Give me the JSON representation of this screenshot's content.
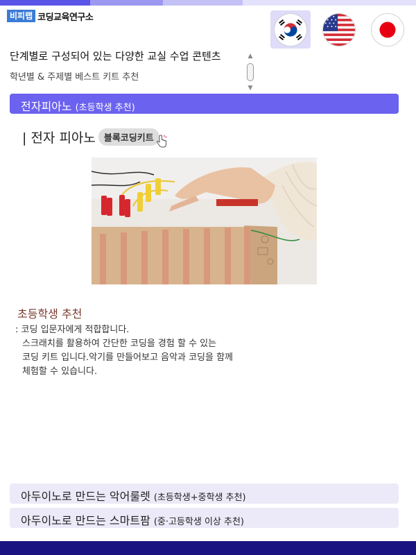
{
  "header": {
    "logo_badge": "비피랩",
    "logo_text": "코딩교육연구소",
    "languages": [
      {
        "code": "ko",
        "icon": "korea-flag-icon",
        "active": true
      },
      {
        "code": "en",
        "icon": "usa-flag-icon",
        "active": false
      },
      {
        "code": "ja",
        "icon": "japan-flag-icon",
        "active": false
      }
    ]
  },
  "intro": {
    "line1": "단계별로 구성되어 있는 다양한 교실 수업 콘텐츠",
    "line2": "학년별 & 주제별 베스트 키트 추천"
  },
  "accordion": [
    {
      "title": "전자피아노",
      "subtitle": "(초등학생 추천)",
      "expanded": true
    },
    {
      "title": "아두이노로 만드는 악어룰렛",
      "subtitle": "(초등학생+중학생 추천)",
      "expanded": false
    },
    {
      "title": "아두이노로 만드는 스마트팜",
      "subtitle": "(중·고등학생 이상 추천)",
      "expanded": false
    }
  ],
  "panel": {
    "heading": "| 전자 피아노",
    "tag": "블록코딩키트",
    "photo_icon": "electronic-piano-kit-photo",
    "recommend_title": "초등학생 추천",
    "desc_lines": [
      ": 코딩 입문자에게 적합합니다.",
      "스크래치를 활용하여 간단한 코딩을 경험 할 수 있는",
      "코딩 키트 입니다.악기를 만들어보고 음악과 코딩을 함께",
      "체험할 수 있습니다."
    ]
  },
  "colors": {
    "accent": "#6b62ef",
    "footer": "#1a1280",
    "accordion_inactive": "#eceaf8",
    "recommend_title": "#7a3a2f"
  }
}
